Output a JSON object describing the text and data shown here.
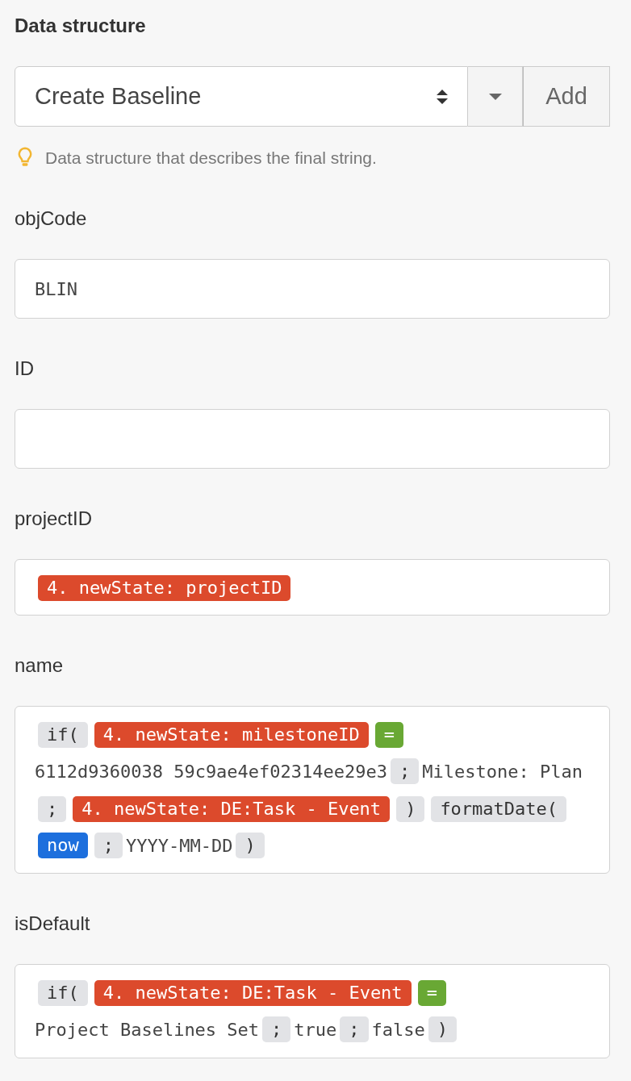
{
  "heading": "Data structure",
  "structure_select": {
    "value": "Create Baseline",
    "add_label": "Add"
  },
  "hint": "Data structure that describes the final string.",
  "fields": [
    {
      "label": "objCode",
      "kind": "text",
      "value": "BLIN"
    },
    {
      "label": "ID",
      "kind": "text"
    },
    {
      "label": "projectID",
      "kind": "tokens",
      "tokens": [
        {
          "kind": "variable",
          "text": "4. newState: projectID"
        }
      ]
    },
    {
      "label": "name",
      "kind": "tokens",
      "tokens": [
        {
          "kind": "function",
          "text": "if("
        },
        {
          "kind": "variable",
          "text": "4. newState: milestoneID"
        },
        {
          "kind": "operator",
          "text": "="
        },
        {
          "kind": "text",
          "text": "6112d9360038"
        },
        {
          "kind": "text",
          "text": "59c9ae4ef02314ee29e3"
        },
        {
          "kind": "separator",
          "text": ";"
        },
        {
          "kind": "text",
          "text": "Milestone: Plan"
        },
        {
          "kind": "separator",
          "text": ";"
        },
        {
          "kind": "variable",
          "text": "4. newState: DE:Task - Event"
        },
        {
          "kind": "separator",
          "text": ")"
        },
        {
          "kind": "function",
          "text": "formatDate("
        },
        {
          "kind": "keyword",
          "text": "now"
        },
        {
          "kind": "separator",
          "text": ";"
        },
        {
          "kind": "text",
          "text": "YYYY-MM-DD"
        },
        {
          "kind": "separator",
          "text": ")"
        }
      ]
    },
    {
      "label": "isDefault",
      "kind": "tokens",
      "tokens": [
        {
          "kind": "function",
          "text": "if("
        },
        {
          "kind": "variable",
          "text": "4. newState: DE:Task - Event"
        },
        {
          "kind": "operator",
          "text": "="
        },
        {
          "kind": "text",
          "text": "Project"
        },
        {
          "kind": "text",
          "text": "Baselines Set"
        },
        {
          "kind": "separator",
          "text": ";"
        },
        {
          "kind": "text",
          "text": "true"
        },
        {
          "kind": "separator",
          "text": ";"
        },
        {
          "kind": "text",
          "text": "false"
        },
        {
          "kind": "separator",
          "text": ")"
        }
      ]
    }
  ]
}
